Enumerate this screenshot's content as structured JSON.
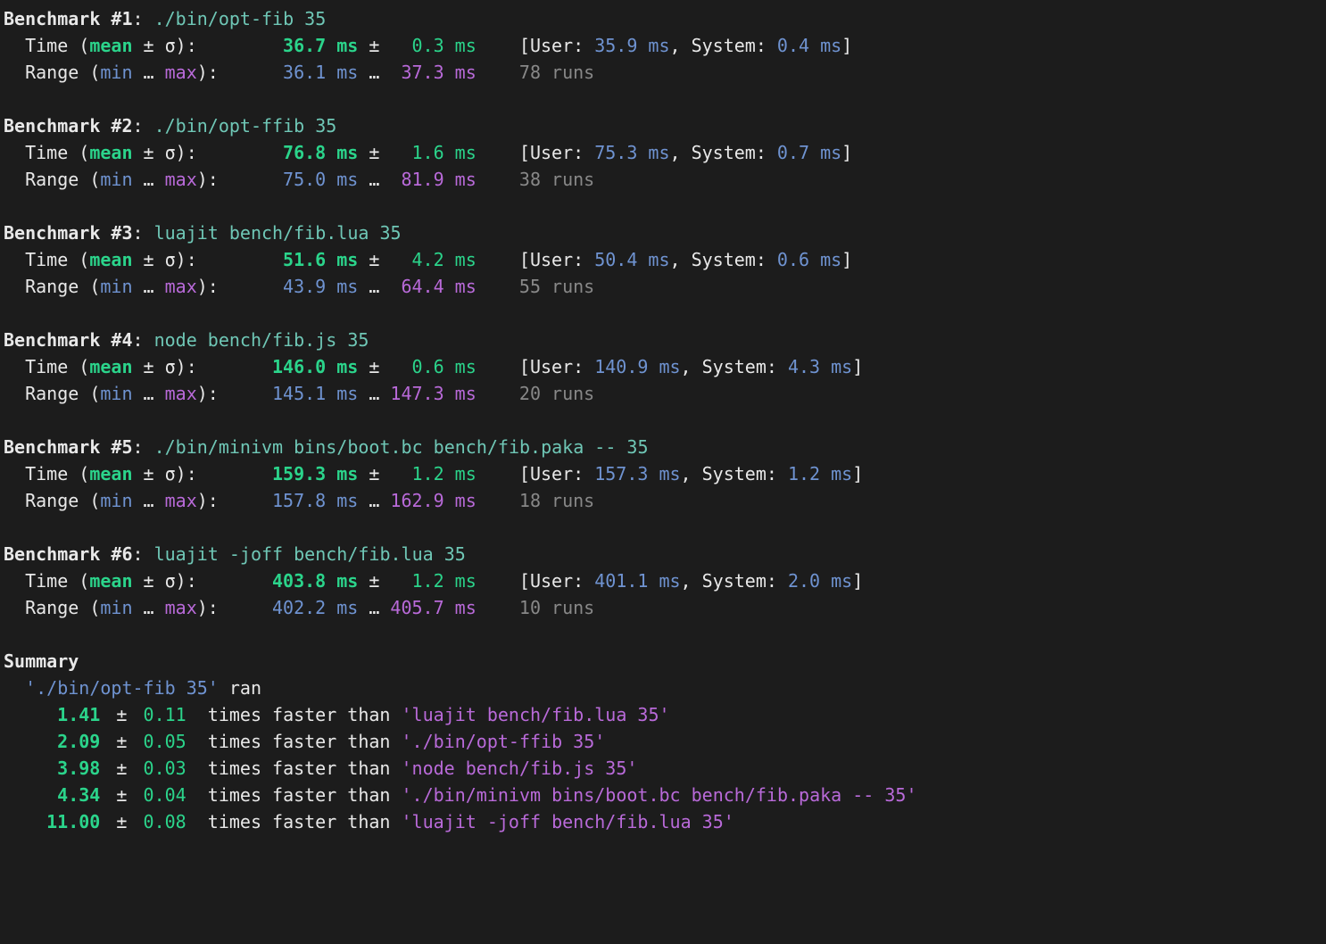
{
  "labels": {
    "benchmark_prefix": "Benchmark #",
    "time_label": "Time (",
    "mean_word": "mean",
    "pm_sigma": " ± σ",
    "time_label_close": "):",
    "range_label_open": "Range (",
    "min_word": "min",
    "range_sep": " … ",
    "max_word": "max",
    "range_label_close": "):",
    "ms": "ms",
    "pm": "±",
    "ellipsis": "…",
    "runs_suffix": "runs",
    "user_label": "[User: ",
    "system_label": ", System: ",
    "close_bracket": "]",
    "summary_title": "Summary",
    "ran_suffix": " ran",
    "times_faster": " times faster than "
  },
  "benchmarks": [
    {
      "num": "1",
      "command": "./bin/opt-fib 35",
      "mean": "36.7",
      "sd": "0.3",
      "user": "35.9",
      "system": "0.4",
      "min": "36.1",
      "max": "37.3",
      "runs": "78"
    },
    {
      "num": "2",
      "command": "./bin/opt-ffib 35",
      "mean": "76.8",
      "sd": "1.6",
      "user": "75.3",
      "system": "0.7",
      "min": "75.0",
      "max": "81.9",
      "runs": "38"
    },
    {
      "num": "3",
      "command": "luajit bench/fib.lua 35",
      "mean": "51.6",
      "sd": "4.2",
      "user": "50.4",
      "system": "0.6",
      "min": "43.9",
      "max": "64.4",
      "runs": "55"
    },
    {
      "num": "4",
      "command": "node bench/fib.js 35",
      "mean": "146.0",
      "sd": "0.6",
      "user": "140.9",
      "system": "4.3",
      "min": "145.1",
      "max": "147.3",
      "runs": "20"
    },
    {
      "num": "5",
      "command": "./bin/minivm bins/boot.bc bench/fib.paka -- 35",
      "mean": "159.3",
      "sd": "1.2",
      "user": "157.3",
      "system": "1.2",
      "min": "157.8",
      "max": "162.9",
      "runs": "18"
    },
    {
      "num": "6",
      "command": "luajit -joff bench/fib.lua 35",
      "mean": "403.8",
      "sd": "1.2",
      "user": "401.1",
      "system": "2.0",
      "min": "402.2",
      "max": "405.7",
      "runs": "10"
    }
  ],
  "summary": {
    "fastest": "./bin/opt-fib 35",
    "comparisons": [
      {
        "ratio": "1.41",
        "sd": "0.11",
        "command": "luajit bench/fib.lua 35"
      },
      {
        "ratio": "2.09",
        "sd": "0.05",
        "command": "./bin/opt-ffib 35"
      },
      {
        "ratio": "3.98",
        "sd": "0.03",
        "command": "node bench/fib.js 35"
      },
      {
        "ratio": "4.34",
        "sd": "0.04",
        "command": "./bin/minivm bins/boot.bc bench/fib.paka -- 35"
      },
      {
        "ratio": "11.00",
        "sd": "0.08",
        "command": "luajit -joff bench/fib.lua 35"
      }
    ]
  }
}
